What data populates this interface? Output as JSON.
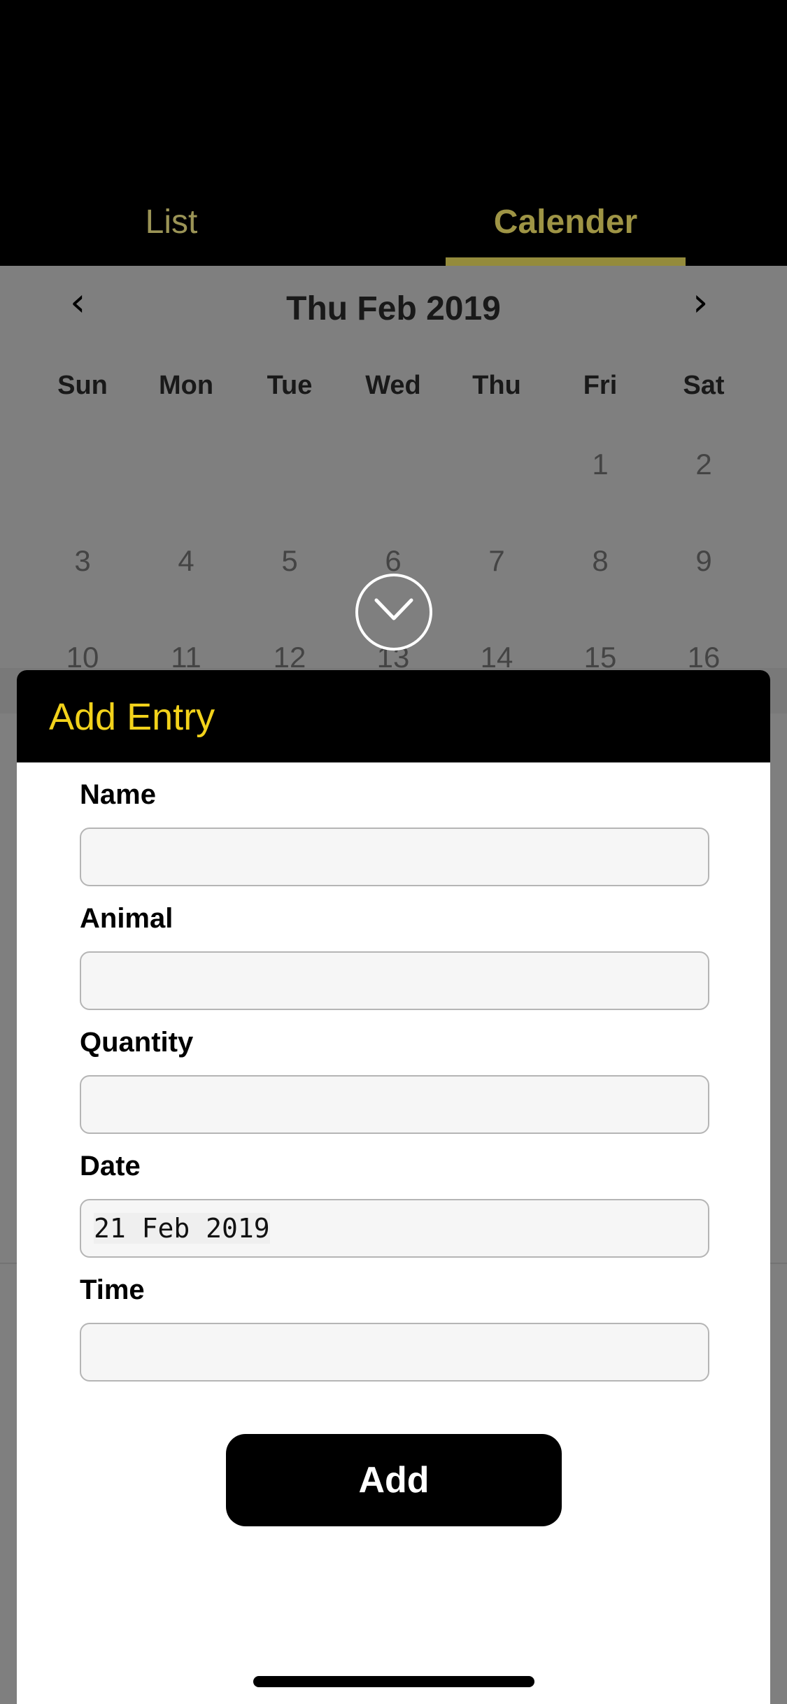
{
  "tabs": {
    "list": "List",
    "calendar": "Calender"
  },
  "calendar": {
    "title": "Thu Feb 2019",
    "prev_icon": "chevron-left-icon",
    "next_icon": "chevron-right-icon",
    "weekdays": [
      "Sun",
      "Mon",
      "Tue",
      "Wed",
      "Thu",
      "Fri",
      "Sat"
    ],
    "rows": [
      [
        "",
        "",
        "",
        "",
        "",
        "1",
        "2"
      ],
      [
        "3",
        "4",
        "5",
        "6",
        "7",
        "8",
        "9"
      ],
      [
        "10",
        "11",
        "12",
        "13",
        "14",
        "15",
        "16"
      ]
    ]
  },
  "collapse_icon": "chevron-down-icon",
  "sheet": {
    "title": "Add Entry",
    "fields": {
      "name": {
        "label": "Name",
        "value": ""
      },
      "animal": {
        "label": "Animal",
        "value": ""
      },
      "quantity": {
        "label": "Quantity",
        "value": ""
      },
      "date": {
        "label": "Date",
        "value": "21 Feb 2019"
      },
      "time": {
        "label": "Time",
        "value": ""
      }
    },
    "add_label": "Add"
  },
  "colors": {
    "accent_tab": "#9e9445",
    "sheet_title": "#f2d21b"
  }
}
